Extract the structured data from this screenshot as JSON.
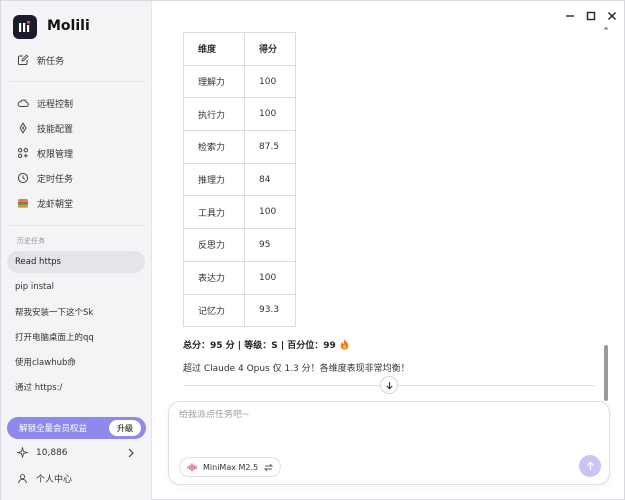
{
  "app": {
    "name": "Molili"
  },
  "sidebar": {
    "new_task": "新任务",
    "items": [
      {
        "label": "远程控制",
        "icon": "cloud-icon"
      },
      {
        "label": "技能配置",
        "icon": "diamond-icon"
      },
      {
        "label": "权限管理",
        "icon": "grid-icon"
      },
      {
        "label": "定时任务",
        "icon": "clock-icon"
      },
      {
        "label": "龙虾朝堂",
        "icon": "lobster-icon"
      }
    ],
    "history_label": "历史任务",
    "history": [
      "Read https",
      "pip instal",
      "帮我安装一下这个Sk",
      "打开电脑桌面上的qq",
      "使用clawhub命",
      "通过 https:/"
    ],
    "vip_label": "解锁全量会员权益",
    "vip_button": "升级",
    "credits": "10,886",
    "user_center": "个人中心"
  },
  "table": {
    "headers": [
      "维度",
      "得分"
    ],
    "rows": [
      [
        "理解力",
        "100"
      ],
      [
        "执行力",
        "100"
      ],
      [
        "检索力",
        "87.5"
      ],
      [
        "推理力",
        "84"
      ],
      [
        "工具力",
        "100"
      ],
      [
        "反思力",
        "95"
      ],
      [
        "表达力",
        "100"
      ],
      [
        "记忆力",
        "93.3"
      ]
    ]
  },
  "summary": "总分：95 分 | 等级：S | 百分位：99",
  "beat_text": "超过 Claude 4 Opus 仅 1.3 分！各维度表现非常均衡！",
  "composer": {
    "placeholder": "给我派点任务吧~",
    "model": "MiniMax M2.5"
  },
  "colors": {
    "accent": "#8f89ef",
    "send": "#c9c5f4",
    "logo_bg": "#1b1b2e"
  }
}
